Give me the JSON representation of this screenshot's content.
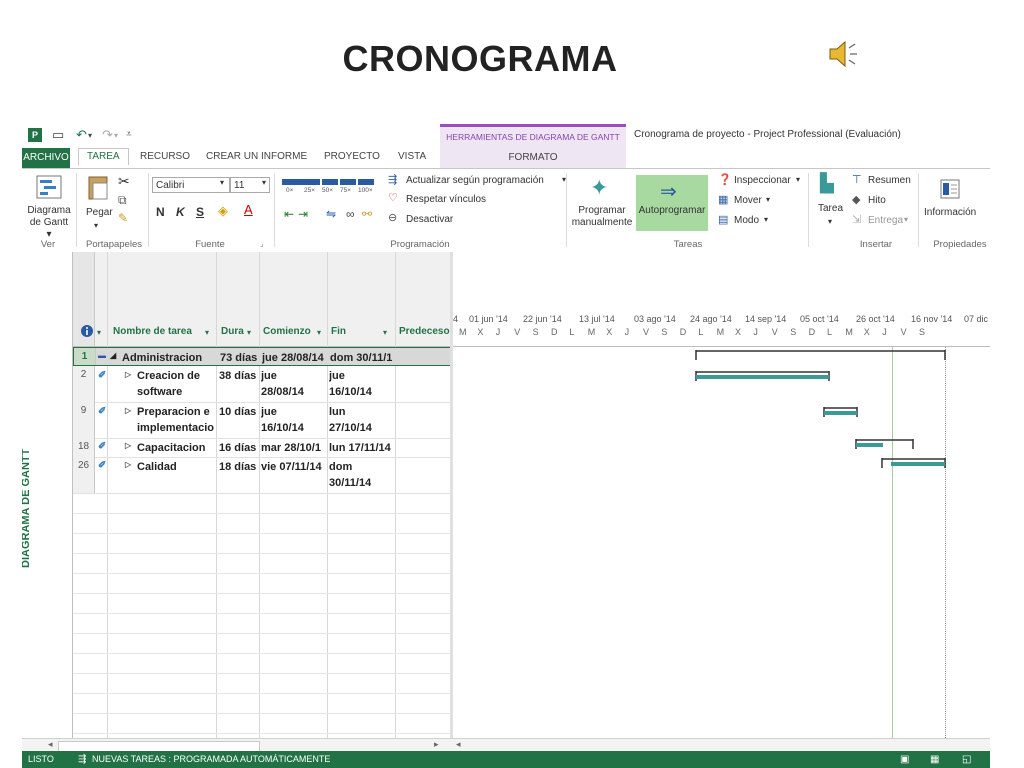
{
  "slide": {
    "title": "CRONOGRAMA"
  },
  "window": {
    "title": "Cronograma de proyecto - Project Professional (Evaluación)",
    "context_tab_header": "HERRAMIENTAS DE DIAGRAMA DE GANTT"
  },
  "tabs": [
    "ARCHIVO",
    "TAREA",
    "RECURSO",
    "CREAR UN INFORME",
    "PROYECTO",
    "VISTA",
    "FORMATO"
  ],
  "ribbon": {
    "ver": {
      "gantt_label": "Diagrama\nde Gantt ▾",
      "group": "Ver"
    },
    "portapapeles": {
      "paste": "Pegar",
      "group": "Portapapeles"
    },
    "fuente": {
      "font": "Calibri",
      "size": "11",
      "bold": "N",
      "italic": "K",
      "underline": "S",
      "group": "Fuente"
    },
    "programacion": {
      "pcts": [
        "0×",
        "25×",
        "50×",
        "75×",
        "100×"
      ],
      "update": "Actualizar según programación",
      "respect": "Respetar vínculos",
      "deactivate": "Desactivar",
      "group": "Programación"
    },
    "tareas": {
      "manual": "Programar\nmanualmente",
      "auto": "Autoprogramar",
      "inspect": "Inspeccionar",
      "move": "Mover",
      "mode": "Modo",
      "group": "Tareas"
    },
    "insertar": {
      "task": "Tarea",
      "summary": "Resumen",
      "milestone": "Hito",
      "deliverable": "Entrega",
      "group": "Insertar"
    },
    "propiedades": {
      "info": "Información",
      "group": "Propiedades"
    }
  },
  "columns": [
    "Nombre de tarea",
    "Dura",
    "Comienzo",
    "Fin",
    "Predeceso"
  ],
  "rows": [
    {
      "id": "1",
      "name": "Administracion",
      "dur": "73 días",
      "start": "jue 28/08/14",
      "end": "dom 30/11/1",
      "summary": true
    },
    {
      "id": "2",
      "name": "Creacion de\nsoftware",
      "dur": "38 días",
      "start": "jue\n28/08/14",
      "end": "jue\n16/10/14"
    },
    {
      "id": "9",
      "name": "Preparacion e\nimplementacio",
      "dur": "10 días",
      "start": "jue\n16/10/14",
      "end": "lun\n27/10/14"
    },
    {
      "id": "18",
      "name": "Capacitacion",
      "dur": "16 días",
      "start": "mar 28/10/1",
      "end": "lun 17/11/14"
    },
    {
      "id": "26",
      "name": "Calidad",
      "dur": "18 días",
      "start": "vie 07/11/14",
      "end": "dom\n30/11/14"
    }
  ],
  "timescale": {
    "top": [
      "4",
      "01 jun '14",
      "22 jun '14",
      "13 jul '14",
      "03 ago '14",
      "24 ago '14",
      "14 sep '14",
      "05 oct '14",
      "26 oct '14",
      "16 nov '14",
      "07 dic"
    ],
    "days": [
      "M",
      "X",
      "J",
      "V",
      "S",
      "D",
      "L",
      "M",
      "X",
      "J",
      "V",
      "S",
      "D",
      "L",
      "M",
      "X",
      "J",
      "V",
      "S",
      "D",
      "L",
      "M",
      "X",
      "J",
      "V",
      "S"
    ]
  },
  "status": {
    "left": "LISTO",
    "mode": "NUEVAS TAREAS : PROGRAMADA AUTOMÁTICAMENTE"
  },
  "side_label": "DIAGRAMA DE GANTT",
  "colors": {
    "accent": "#217346",
    "bar": "#3a9a9a",
    "context": "#9b4fbf"
  }
}
